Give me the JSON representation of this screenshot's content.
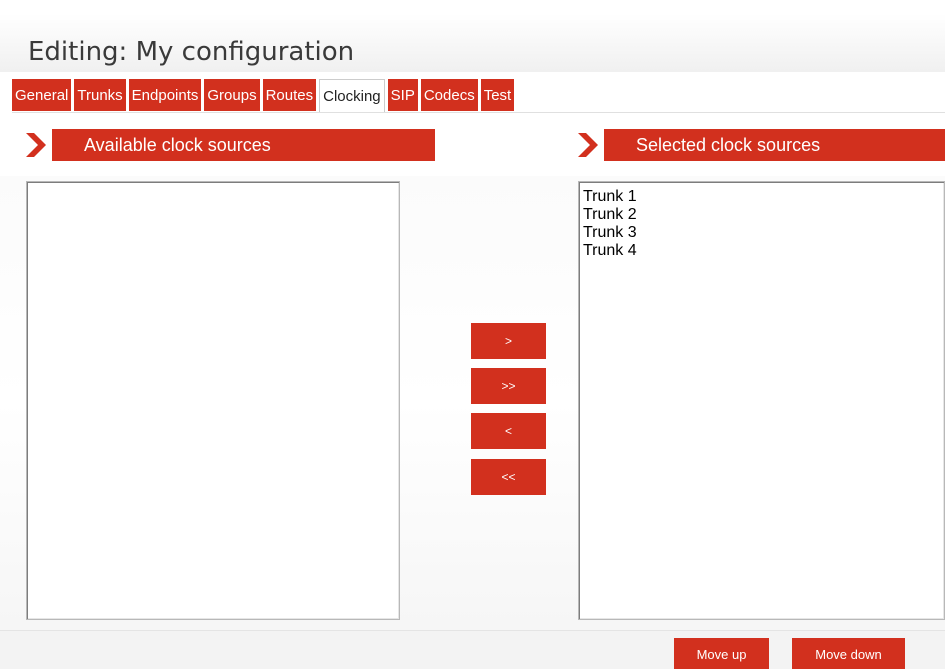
{
  "header": {
    "title": "Editing: My configuration"
  },
  "tabs": [
    {
      "label": "General"
    },
    {
      "label": "Trunks"
    },
    {
      "label": "Endpoints"
    },
    {
      "label": "Groups"
    },
    {
      "label": "Routes"
    },
    {
      "label": "Clocking",
      "active": true
    },
    {
      "label": "SIP"
    },
    {
      "label": "Codecs"
    },
    {
      "label": "Test"
    }
  ],
  "available": {
    "heading": "Available clock sources",
    "items": []
  },
  "selected": {
    "heading": "Selected clock sources",
    "items": [
      "Trunk 1",
      "Trunk 2",
      "Trunk 3",
      "Trunk 4"
    ]
  },
  "transfer_buttons": {
    "add": ">",
    "add_all": ">>",
    "remove": "<",
    "remove_all": "<<"
  },
  "order_buttons": {
    "move_up": "Move up",
    "move_down": "Move down"
  },
  "colors": {
    "accent": "#d2301e",
    "tab_text": "#ffffff",
    "active_tab_text": "#222222"
  }
}
